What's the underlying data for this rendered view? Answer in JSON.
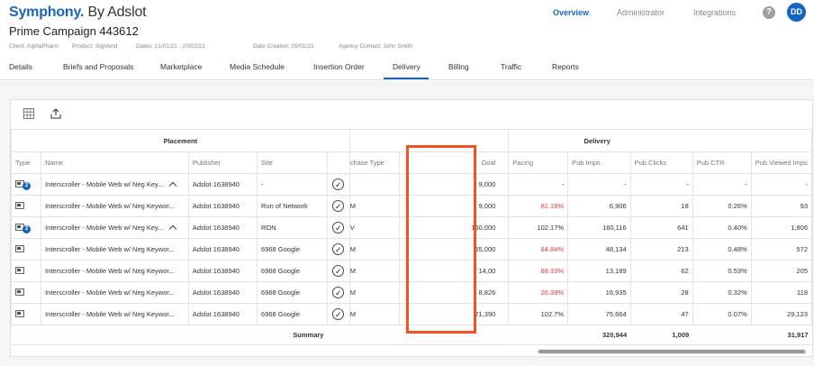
{
  "header": {
    "brand": "Symphony.",
    "by": " By Adslot",
    "nav": [
      {
        "label": "Overview",
        "active": true
      },
      {
        "label": "Administrator",
        "active": false
      },
      {
        "label": "Integrations",
        "active": false
      }
    ],
    "help": "?",
    "avatar": "DD"
  },
  "campaign": {
    "title": "Prime Campaign 443612",
    "client": "Client: AlphaPharm",
    "product": "Product: SigVend",
    "dates": "Dates: 21/01/21 - 20/02/21",
    "created": "Date Created: 05/01/21",
    "agency": "Agency Contact: John Smith"
  },
  "tabs": [
    "Details",
    "Briefs and Proposals",
    "Marketplace",
    "Media Schedule",
    "Insertion Order",
    "Delivery",
    "Billing",
    "Traffic",
    "Reports"
  ],
  "active_tab": "Delivery",
  "toolbar": {
    "icons": [
      "grid-icon",
      "export-icon"
    ]
  },
  "table": {
    "group_placement": "Placement",
    "group_delivery": "Delivery",
    "headers": {
      "type": "Type",
      "name": "Name",
      "publisher": "Publisher",
      "site": "Site",
      "purchase": "chase Type",
      "goal": "Goal",
      "pacing": "Pacing",
      "pub_imps": "Pub Imps",
      "pub_clicks": "Pub Clicks",
      "pub_ctr": "Pub CTR",
      "pub_viewed": "Pub Viewed Imps"
    },
    "rows": [
      {
        "type_icon": "package",
        "badge": "2",
        "name": "Interscroller - Mobile Web w/ Neg Key...",
        "expand": true,
        "publisher": "Adslot 1638940",
        "site": "-",
        "purchase": "",
        "goal": "9,000",
        "pacing": "-",
        "pacing_red": false,
        "pub_imps": "-",
        "pub_clicks": "-",
        "pub_ctr": "-",
        "pub_viewed": "-"
      },
      {
        "type_icon": "single",
        "badge": "",
        "name": "Interscroller - Mobile Web w/ Neg Keywor...",
        "expand": false,
        "publisher": "Adslot 1638940",
        "site": "Run of Network",
        "purchase": "M",
        "goal": "9,000",
        "pacing": "81.16%",
        "pacing_red": true,
        "pub_imps": "6,906",
        "pub_clicks": "18",
        "pub_ctr": "0.26%",
        "pub_viewed": "93"
      },
      {
        "type_icon": "multi",
        "badge": "2",
        "name": "Interscroller - Mobile Web w/ Neg Key...",
        "expand": true,
        "publisher": "Adslot 1638940",
        "site": "RON",
        "purchase": "V",
        "goal": "160,000",
        "pacing": "102.17%",
        "pacing_red": false,
        "pub_imps": "160,116",
        "pub_clicks": "641",
        "pub_ctr": "0.40%",
        "pub_viewed": "1,806"
      },
      {
        "type_icon": "single",
        "badge": "",
        "name": "Interscroller - Mobile Web w/ Neg Keywor...",
        "expand": false,
        "publisher": "Adslot 1638940",
        "site": "6968 Google",
        "purchase": "M",
        "goal": "55,000",
        "pacing": "84.84%",
        "pacing_red": true,
        "pub_imps": "48,134",
        "pub_clicks": "213",
        "pub_ctr": "0.48%",
        "pub_viewed": "572"
      },
      {
        "type_icon": "single",
        "badge": "",
        "name": "Interscroller - Mobile Web w/ Neg Keywor...",
        "expand": false,
        "publisher": "Adslot 1638940",
        "site": "6968 Google",
        "purchase": "M",
        "goal": "14,00",
        "pacing": "88.33%",
        "pacing_red": true,
        "pub_imps": "13,189",
        "pub_clicks": "62",
        "pub_ctr": "0.53%",
        "pub_viewed": "205"
      },
      {
        "type_icon": "single",
        "badge": "",
        "name": "Interscroller - Mobile Web w/ Neg Keywor...",
        "expand": false,
        "publisher": "Adslot 1638940",
        "site": "6968 Google",
        "purchase": "M",
        "goal": "8,826",
        "pacing": "26.39%",
        "pacing_red": true,
        "pub_imps": "16,935",
        "pub_clicks": "28",
        "pub_ctr": "0.32%",
        "pub_viewed": "118"
      },
      {
        "type_icon": "single",
        "badge": "",
        "name": "Interscroller - Mobile Web w/ Neg Keywor...",
        "expand": false,
        "publisher": "Adslot 1638940",
        "site": "6968 Google",
        "purchase": "M",
        "goal": "71,390",
        "pacing": "102.7%",
        "pacing_red": false,
        "pub_imps": "75,664",
        "pub_clicks": "47",
        "pub_ctr": "0.07%",
        "pub_viewed": "29,123"
      }
    ],
    "summary": {
      "label": "Summary",
      "pub_imps": "320,944",
      "pub_clicks": "1,009",
      "pub_viewed": "31,917"
    }
  },
  "colors": {
    "brand": "#1565c0",
    "negative": "#e53935",
    "highlight": "#f4511e"
  }
}
